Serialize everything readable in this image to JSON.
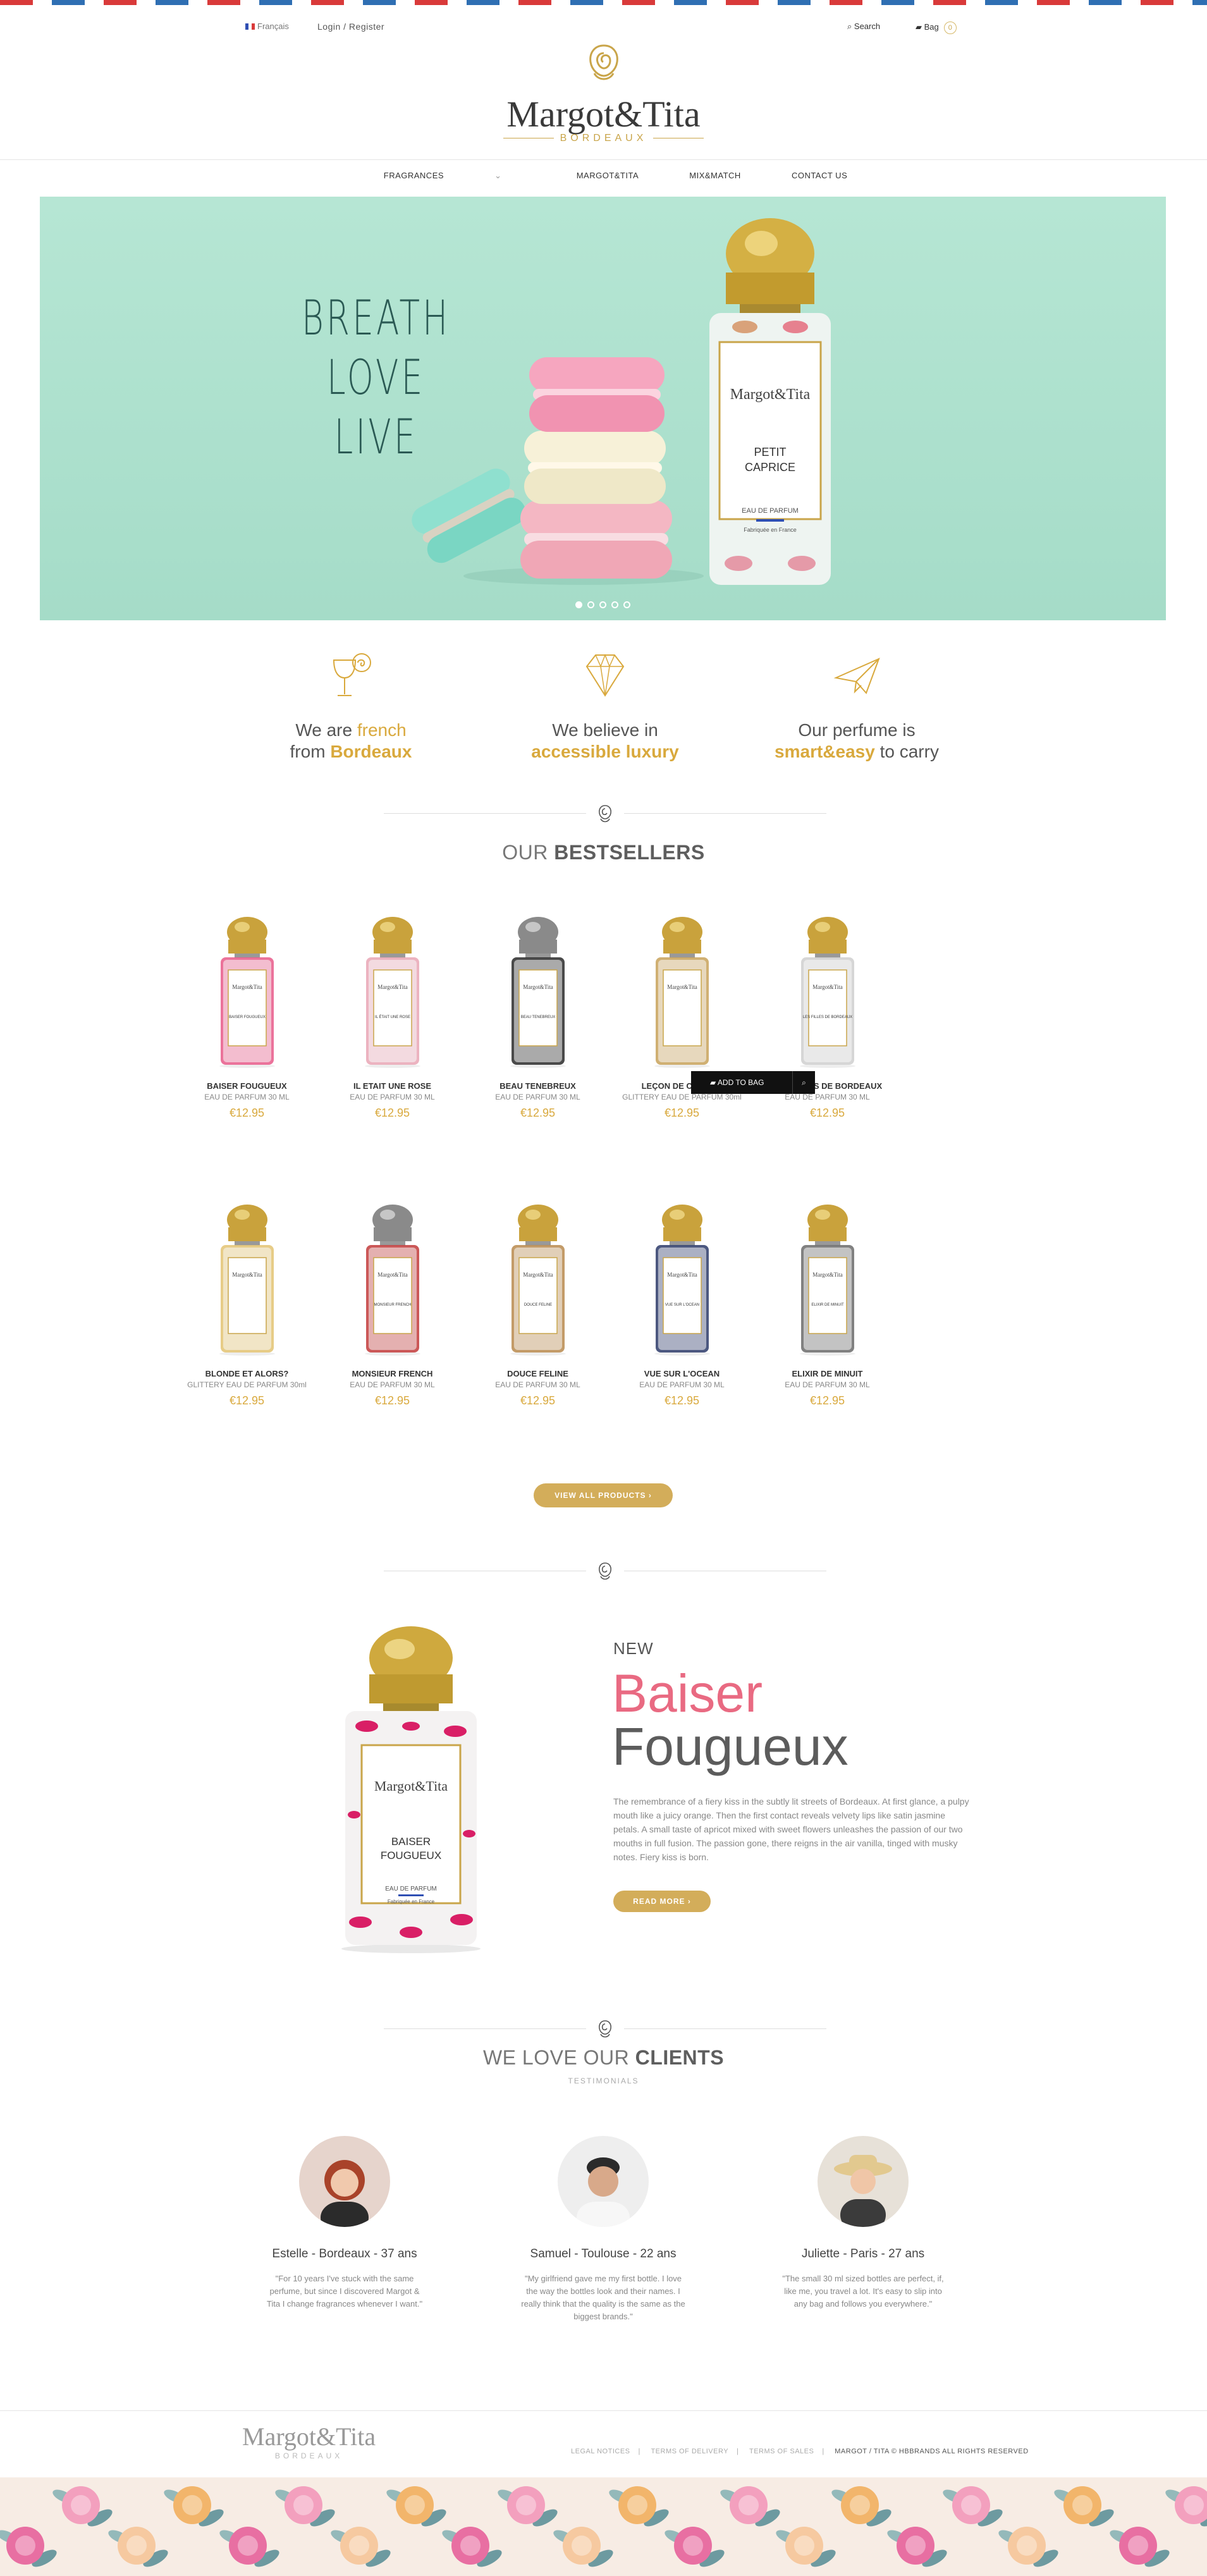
{
  "topbar": {
    "language": "Français",
    "login": "Login / Register",
    "search": "Search",
    "bag": "Bag",
    "bag_count": "0"
  },
  "brand": {
    "name": "Margot&Tita",
    "sub": "BORDEAUX"
  },
  "nav": {
    "items": [
      "FRAGRANCES",
      "MARGOT&TITA",
      "MIX&MATCH",
      "CONTACT US"
    ]
  },
  "hero": {
    "line1": "BREATH",
    "line2": "LOVE",
    "line3": "LIVE",
    "bottle_brand": "Margot&Tita",
    "bottle_name_1": "PETIT",
    "bottle_name_2": "CAPRICE",
    "bottle_type": "EAU DE PARFUM",
    "bottle_made": "Fabriquée en France",
    "active_slide": 1,
    "slides": 5
  },
  "features": [
    {
      "pre": "We are ",
      "hl1": "french",
      "mid": "from ",
      "hl2": "Bordeaux",
      "post": ""
    },
    {
      "pre": "We believe in",
      "hl1": "",
      "mid": "",
      "hl2": "accessible  luxury",
      "post": ""
    },
    {
      "pre": "Our perfume is",
      "hl1": "",
      "mid": "",
      "hl2": "smart&easy",
      "post": " to carry"
    }
  ],
  "bestsellers": {
    "title_light": "OUR ",
    "title_bold": "BESTSELLERS",
    "add_to_bag": "ADD TO BAG",
    "products": [
      {
        "name": "BAISER FOUGUEUX",
        "desc": "EAU DE PARFUM 30 ML",
        "price": "€12.95",
        "cap": "#c9a23c",
        "label": "BAISER FOUGUEUX",
        "pattern": "#e85a8a"
      },
      {
        "name": "IL ETAIT UNE ROSE",
        "desc": "EAU DE PARFUM 30 ML",
        "price": "€12.95",
        "cap": "#c9a23c",
        "label": "IL ÉTAIT UNE ROSE",
        "pattern": "#e9a6b5"
      },
      {
        "name": "BEAU TENEBREUX",
        "desc": "EAU DE PARFUM 30 ML",
        "price": "€12.95",
        "cap": "#8a8a8a",
        "label": "BEAU TENEBREUX",
        "pattern": "#2a2a2a"
      },
      {
        "name": "LEÇON DE CHARME",
        "desc": "GLITTERY EAU DE PARFUM 30ml",
        "price": "€12.95",
        "cap": "#c9a23c",
        "label": "",
        "pattern": "#c8a25a"
      },
      {
        "name": "LES FILLES DE BORDEAUX",
        "desc": "EAU DE PARFUM 30 ML",
        "price": "€12.95",
        "cap": "#c9a23c",
        "label": "LES FILLES DE BORDEAUX",
        "pattern": "#cfcfcf"
      },
      {
        "name": "BLONDE ET ALORS?",
        "desc": "GLITTERY EAU DE PARFUM 30ml",
        "price": "€12.95",
        "cap": "#c9a23c",
        "label": "",
        "pattern": "#e3c372"
      },
      {
        "name": "MONSIEUR FRENCH",
        "desc": "EAU DE PARFUM 30 ML",
        "price": "€12.95",
        "cap": "#8a8a8a",
        "label": "MONSIEUR FRENCH",
        "pattern": "#c23b3b"
      },
      {
        "name": "DOUCE FELINE",
        "desc": "EAU DE PARFUM 30 ML",
        "price": "€12.95",
        "cap": "#c9a23c",
        "label": "DOUCE FELINE",
        "pattern": "#b98a4e"
      },
      {
        "name": "VUE SUR L'OCEAN",
        "desc": "EAU DE PARFUM 30 ML",
        "price": "€12.95",
        "cap": "#c9a23c",
        "label": "VUE SUR L'OCEAN",
        "pattern": "#2d3b6a"
      },
      {
        "name": "ELIXIR DE MINUIT",
        "desc": "EAU DE PARFUM 30 ML",
        "price": "€12.95",
        "cap": "#c9a23c",
        "label": "ELIXIR DE MINUIT",
        "pattern": "#6b6b6b"
      }
    ],
    "view_all": "VIEW ALL PRODUCTS ›"
  },
  "new_product": {
    "label": "NEW",
    "title1": "Baiser",
    "title2": "Fougueux",
    "bottle_brand": "Margot&Tita",
    "bottle_name_1": "BAISER",
    "bottle_name_2": "FOUGUEUX",
    "bottle_type": "EAU DE PARFUM",
    "bottle_made": "Fabriquée en France",
    "description": "The remembrance of a fiery kiss in the subtly lit streets of Bordeaux. At first glance, a pulpy mouth like a juicy orange. Then the first contact reveals velvety lips like satin jasmine petals. A small taste of apricot mixed with sweet flowers unleashes the passion of our two mouths in full fusion. The passion gone, there reigns in the air vanilla, tinged with musky notes. Fiery kiss is born.",
    "read_more": "READ MORE ›"
  },
  "clients": {
    "title_light": "WE LOVE OUR ",
    "title_bold": "CLIENTS",
    "subtitle": "TESTIMONIALS",
    "items": [
      {
        "name": "Estelle - Bordeaux - 37 ans",
        "quote": "\"For 10 years I've stuck with the same perfume, but since I discovered Margot & Tita I change fragrances whenever I want.\""
      },
      {
        "name": "Samuel - Toulouse - 22 ans",
        "quote": "\"My girlfriend gave me my first bottle. I love the way the bottles look and their names. I really think that the quality is the same as the biggest brands.\""
      },
      {
        "name": "Juliette - Paris - 27 ans",
        "quote": "\"The small 30 ml sized bottles are perfect, if, like me, you travel a lot. It's easy to slip into any bag and follows you everywhere.\""
      }
    ]
  },
  "footer": {
    "brand": "Margot&Tita",
    "sub": "BORDEAUX",
    "links": [
      "LEGAL NOTICES",
      "TERMS OF DELIVERY",
      "TERMS OF SALES"
    ],
    "copyright": "MARGOT / TITA © HBBRANDS ALL RIGHTS RESERVED"
  }
}
